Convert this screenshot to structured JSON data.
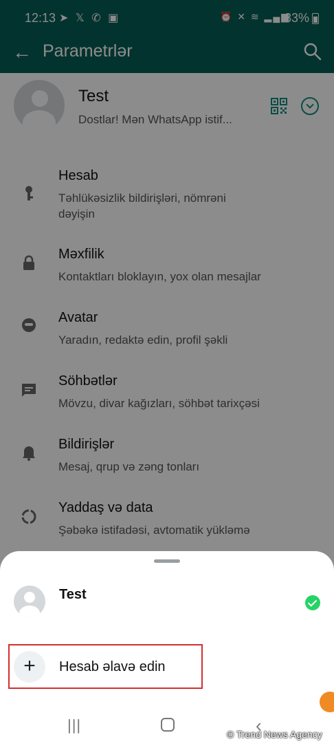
{
  "status_bar": {
    "time": "12:13",
    "battery": "83%",
    "left_icons": [
      "telegram-icon",
      "x-icon",
      "whatsapp-icon",
      "gallery-icon"
    ],
    "right_icons": [
      "alarm-icon",
      "mute-icon",
      "wifi-icon",
      "signal-icon",
      "signal-icon"
    ]
  },
  "header": {
    "title": "Parametrlər"
  },
  "profile": {
    "name": "Test",
    "about": "Dostlar! Mən WhatsApp istif..."
  },
  "settings": [
    {
      "title": "Hesab",
      "subtitle": "Təhlükəsizlik bildirişləri, nömrəni dəyişin",
      "icon": "key-icon"
    },
    {
      "title": "Məxfilik",
      "subtitle": "Kontaktları bloklayın, yox olan mesajlar",
      "icon": "lock-icon"
    },
    {
      "title": "Avatar",
      "subtitle": "Yaradın, redaktə edin, profil şəkli",
      "icon": "avatar-icon"
    },
    {
      "title": "Söhbətlər",
      "subtitle": "Mövzu, divar kağızları, söhbət tarixçəsi",
      "icon": "chat-icon"
    },
    {
      "title": "Bildirişlər",
      "subtitle": "Mesaj, qrup və zəng tonları",
      "icon": "bell-icon"
    },
    {
      "title": "Yaddaş və data",
      "subtitle": "Şəbəkə istifadəsi, avtomatik yükləmə",
      "icon": "storage-icon"
    }
  ],
  "sheet": {
    "account_name": "Test",
    "add_account_label": "Hesab əlavə edin"
  },
  "watermark": "© Trend News Agency",
  "colors": {
    "header": "#075e54",
    "accent": "#128c7e",
    "check": "#25d366",
    "highlight_border": "#d32f2f"
  }
}
